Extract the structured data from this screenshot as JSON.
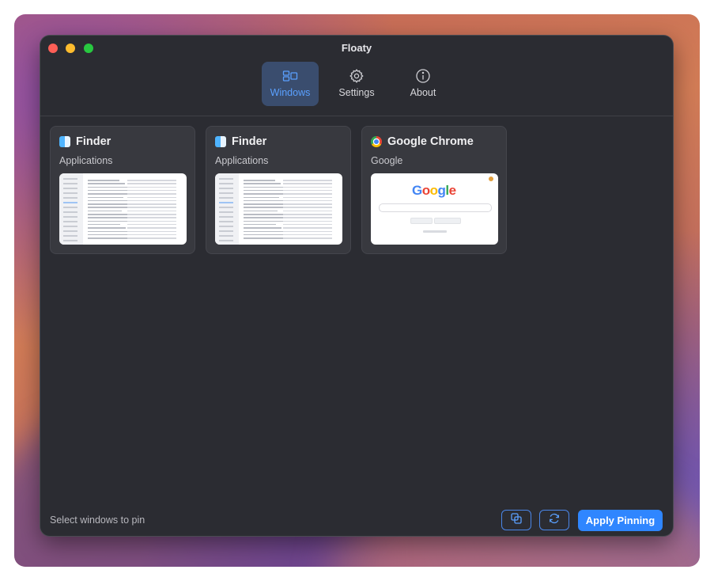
{
  "window": {
    "title": "Floaty"
  },
  "tabs": [
    {
      "label": "Windows",
      "icon": "windows-layout-icon",
      "active": true
    },
    {
      "label": "Settings",
      "icon": "gear-icon",
      "active": false
    },
    {
      "label": "About",
      "icon": "info-icon",
      "active": false
    }
  ],
  "cards": [
    {
      "app": "Finder",
      "title": "Applications",
      "icon": "finder-icon",
      "thumbnail": "finder-window-thumbnail"
    },
    {
      "app": "Finder",
      "title": "Applications",
      "icon": "finder-icon",
      "thumbnail": "finder-window-thumbnail"
    },
    {
      "app": "Google Chrome",
      "title": "Google",
      "icon": "chrome-icon",
      "thumbnail": "chrome-window-thumbnail",
      "thumb_logo": "Google"
    }
  ],
  "footer": {
    "status": "Select windows to pin",
    "copy_icon": "copy-windows-icon",
    "refresh_icon": "refresh-icon",
    "apply_label": "Apply Pinning"
  },
  "colors": {
    "accent": "#2f86ff",
    "window_bg": "#2b2c32",
    "card_bg": "#38393f",
    "active_tab_bg": "#3a4d6e"
  }
}
